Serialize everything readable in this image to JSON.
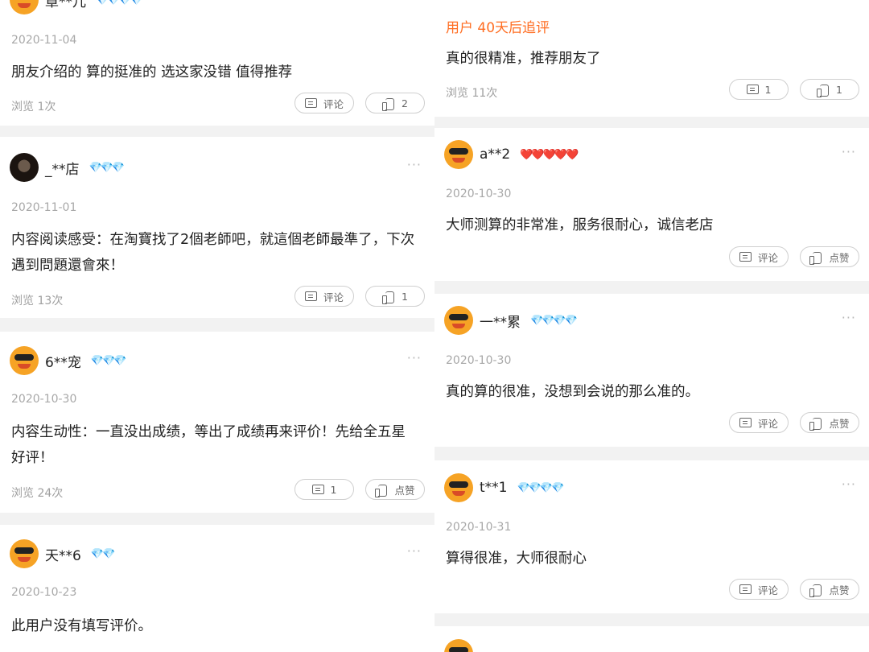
{
  "left_cards": [
    {
      "user": "章**儿",
      "badges": "💎💎💎💎",
      "badge_type": "diamond",
      "date": "2020-11-04",
      "text": "朋友介绍的   算的挺准的  选这家没错   值得推荐",
      "views": "浏览 1次",
      "comment": "评论",
      "like": "2"
    },
    {
      "user": "_**店",
      "badges": "💎💎💎",
      "badge_type": "diamond",
      "date": "2020-11-01",
      "text": "内容阅读感受：在淘寶找了2個老師吧，就這個老師最準了，下次遇到問題還會來！",
      "views": "浏览 13次",
      "comment": "评论",
      "like": "1"
    },
    {
      "user": "6**宠",
      "badges": "💎💎💎",
      "badge_type": "diamond",
      "date": "2020-10-30",
      "text": "内容生动性：一直没出成绩，等出了成绩再来评价！先给全五星好评！",
      "views": "浏览 24次",
      "comment": "1",
      "like": "点赞"
    },
    {
      "user": "天**6",
      "badges": "💎💎",
      "badge_type": "diamond",
      "date": "2020-10-23",
      "text": "此用户没有填写评价。"
    }
  ],
  "right_top": {
    "tag": "用户 40天后追评",
    "text": "真的很精准，推荐朋友了",
    "views": "浏览 11次",
    "comment": "1",
    "like": "1"
  },
  "right_cards": [
    {
      "user": "a**2",
      "badges": "❤️❤️❤️❤️❤️",
      "badge_type": "heart",
      "date": "2020-10-30",
      "text": "大师测算的非常准，服务很耐心，诚信老店",
      "comment": "评论",
      "like": "点赞"
    },
    {
      "user": "一**累",
      "badges": "💎💎💎💎",
      "badge_type": "diamond",
      "date": "2020-10-30",
      "text": "真的算的很准，没想到会说的那么准的。",
      "comment": "评论",
      "like": "点赞"
    },
    {
      "user": "t**1",
      "badges": "💎💎💎💎",
      "badge_type": "diamond",
      "date": "2020-10-31",
      "text": "算得很准，大师很耐心",
      "comment": "评论",
      "like": "点赞"
    }
  ],
  "more_icon": "more-icon",
  "comment_icon": "comment-icon",
  "like_icon": "thumb-up-icon"
}
